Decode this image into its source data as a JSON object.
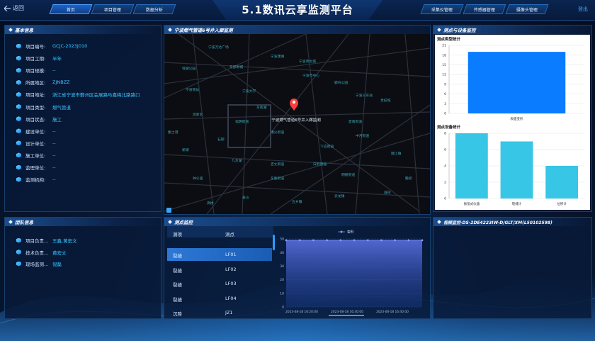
{
  "header": {
    "back_label": "返回",
    "title": "5.1数讯云享监测平台",
    "logout": "登出",
    "nav_left": [
      "首页",
      "项目管理",
      "数据分析"
    ],
    "nav_right": [
      "采集仪管理",
      "传感器管理",
      "摄像头管理"
    ]
  },
  "basic_info": {
    "title": "基本信息",
    "rows": [
      {
        "label": "项目编号:",
        "value": "GCJC-2023J010"
      },
      {
        "label": "项目工期:",
        "value": "半年"
      },
      {
        "label": "项目规模:",
        "value": "--"
      },
      {
        "label": "所属地区:",
        "value": "ZJNBZZ"
      },
      {
        "label": "项目地址:",
        "value": "浙江省宁波市鄞州区会展路与嘉梅北路路口"
      },
      {
        "label": "项目类型:",
        "value": "燃气管道"
      },
      {
        "label": "项目状态:",
        "value": "施工"
      },
      {
        "label": "建设单位:",
        "value": "--"
      },
      {
        "label": "设计单位:",
        "value": "--"
      },
      {
        "label": "施工单位:",
        "value": "--"
      },
      {
        "label": "监理单位:",
        "value": "--"
      },
      {
        "label": "监测机构:",
        "value": "--"
      }
    ]
  },
  "team_info": {
    "title": "团队信息",
    "rows": [
      {
        "label": "项目负责...",
        "value": "王鑫,黄宏文"
      },
      {
        "label": "技术负责...",
        "value": "黄宏文"
      },
      {
        "label": "现场监测...",
        "value": "倪磊"
      }
    ]
  },
  "map": {
    "title": "宁波燃气管道6号井入廊监测",
    "pin_label": "宁波燃气管道6号井入廊监测",
    "labels": [
      "宁波万达广场",
      "宁波康湖",
      "宁波青创城",
      "钱湖公园",
      "东部新城",
      "宁波市中心",
      "宁波火车站",
      "宁波大学",
      "东钱湖",
      "鄞州公园",
      "宁波南站",
      "世纪城",
      "高新区",
      "福明街道",
      "潘火街道",
      "首南街道",
      "中河街道",
      "下应街道",
      "新碶",
      "九龙湖",
      "百丈街道",
      "白鹤街道",
      "明楼街道",
      "东胜街道",
      "鄞江镇",
      "钟公庙",
      "姜山",
      "五乡镇",
      "云龙镇",
      "咸祥",
      "瞻岐",
      "高桥",
      "集士港",
      "石碶"
    ]
  },
  "survey": {
    "title": "测点监控",
    "col1": "测项",
    "col2": "测点",
    "rows": [
      {
        "item": "裂缝",
        "point": "LF01"
      },
      {
        "item": "裂缝",
        "point": "LF02"
      },
      {
        "item": "裂缝",
        "point": "LF03"
      },
      {
        "item": "裂缝",
        "point": "LF04"
      },
      {
        "item": "沉降",
        "point": "JZ1"
      }
    ],
    "chart_legend": "变形"
  },
  "device": {
    "title": "测点与设备监控",
    "chart1_title": "测点类型统计",
    "chart2_title": "测点设备统计"
  },
  "video": {
    "title": "视频监控-DS-2DE4223IW-D/GLT/XM(L50102598)"
  },
  "colors": {
    "accent": "#2b9bff",
    "bar_blue": "#0a7cff",
    "bar_cyan": "#37c6e6",
    "value_text": "#39c7ff"
  },
  "chart_data": [
    {
      "type": "bar",
      "title": "测点类型统计",
      "categories": [
        "表面变形"
      ],
      "values": [
        19
      ],
      "ylim": [
        0,
        21
      ],
      "yticks": [
        0,
        3,
        6,
        9,
        12,
        15,
        18,
        21
      ],
      "grid": true
    },
    {
      "type": "bar",
      "title": "测点设备统计",
      "categories": [
        "振弦式仪器",
        "裂缝计",
        "位移计"
      ],
      "values": [
        8,
        7,
        4
      ],
      "ylim": [
        0,
        8
      ],
      "yticks": [
        0,
        2,
        4,
        6,
        8
      ],
      "grid": true
    },
    {
      "type": "area",
      "series": [
        {
          "name": "变形",
          "values": [
            49,
            49,
            49,
            49,
            49,
            49,
            49,
            49,
            49,
            49,
            49
          ]
        }
      ],
      "x": [
        "2023-08-18 16:20:00",
        "2023-08-18 16:30:00",
        "2023-08-18 16:40:00"
      ],
      "ylim": [
        0,
        50
      ],
      "yticks": [
        0,
        10,
        20,
        30,
        40,
        50
      ],
      "grid": true,
      "legend": "top-center"
    }
  ]
}
